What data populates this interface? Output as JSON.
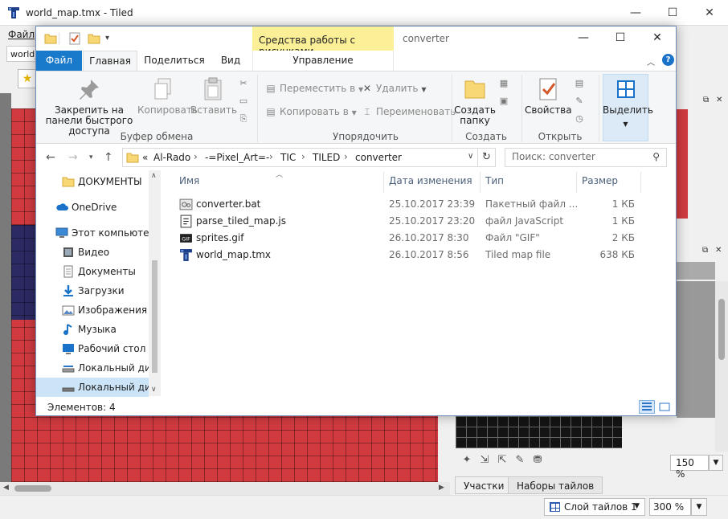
{
  "tiled": {
    "title": "world_map.tmx - Tiled",
    "menu_file": "Файл",
    "doc_tab": "world_",
    "zoom_tileset": "150 %",
    "bottom_tabs": [
      "Участки",
      "Наборы тайлов"
    ],
    "layer_select": "Слой тайлов 1",
    "zoom_map": "300 %",
    "colors": {
      "map_red": "#d13b40",
      "map_dark": "#2c2a63",
      "tileset_bg": "#141414"
    }
  },
  "explorer": {
    "folder_title": "converter",
    "context_tab_header": "Средства работы с рисунками",
    "tabs": [
      "Файл",
      "Главная",
      "Поделиться",
      "Вид"
    ],
    "manage_tab": "Управление",
    "ribbon": {
      "pin": "Закрепить на панели быстрого доступа",
      "copy": "Копировать",
      "paste": "Вставить",
      "group_clipboard": "Буфер обмена",
      "move_to": "Переместить в",
      "copy_to": "Копировать в",
      "delete": "Удалить",
      "rename": "Переименовать",
      "group_organize": "Упорядочить",
      "new_folder": "Создать папку",
      "group_create": "Создать",
      "properties": "Свойства",
      "group_open": "Открыть",
      "select": "Выделить"
    },
    "address": [
      "Al-Rado",
      "-=Pixel_Art=-",
      "TIC",
      "TILED",
      "converter"
    ],
    "address_prefix": "«",
    "search_placeholder": "Поиск: converter",
    "nav_items": [
      {
        "label": "ДОКУМЕНТЫ",
        "icon": "folder-icon"
      },
      {
        "label": "OneDrive",
        "icon": "cloud-icon"
      },
      {
        "label": "Этот компьютер",
        "icon": "computer-icon"
      },
      {
        "label": "Видео",
        "icon": "video-icon"
      },
      {
        "label": "Документы",
        "icon": "documents-icon"
      },
      {
        "label": "Загрузки",
        "icon": "download-icon"
      },
      {
        "label": "Изображения",
        "icon": "pictures-icon"
      },
      {
        "label": "Музыка",
        "icon": "music-icon"
      },
      {
        "label": "Рабочий стол",
        "icon": "desktop-icon"
      },
      {
        "label": "Локальный дис",
        "icon": "drive-icon"
      },
      {
        "label": "Локальный дис",
        "icon": "drive-icon"
      }
    ],
    "columns": [
      "Имя",
      "Дата изменения",
      "Тип",
      "Размер"
    ],
    "files": [
      {
        "name": "converter.bat",
        "date": "25.10.2017 23:39",
        "type": "Пакетный файл ...",
        "size": "1 КБ",
        "icon": "batch-file-icon"
      },
      {
        "name": "parse_tiled_map.js",
        "date": "25.10.2017 23:20",
        "type": "файл JavaScript",
        "size": "1 КБ",
        "icon": "script-file-icon"
      },
      {
        "name": "sprites.gif",
        "date": "26.10.2017 8:30",
        "type": "Файл \"GIF\"",
        "size": "2 КБ",
        "icon": "gif-file-icon"
      },
      {
        "name": "world_map.tmx",
        "date": "26.10.2017 8:56",
        "type": "Tiled map file",
        "size": "638 КБ",
        "icon": "tiled-file-icon"
      }
    ],
    "status": "Элементов: 4",
    "colors": {
      "file_tab": "#1979ca",
      "context_band": "#fbef97",
      "selection": "#cce4f7"
    }
  }
}
